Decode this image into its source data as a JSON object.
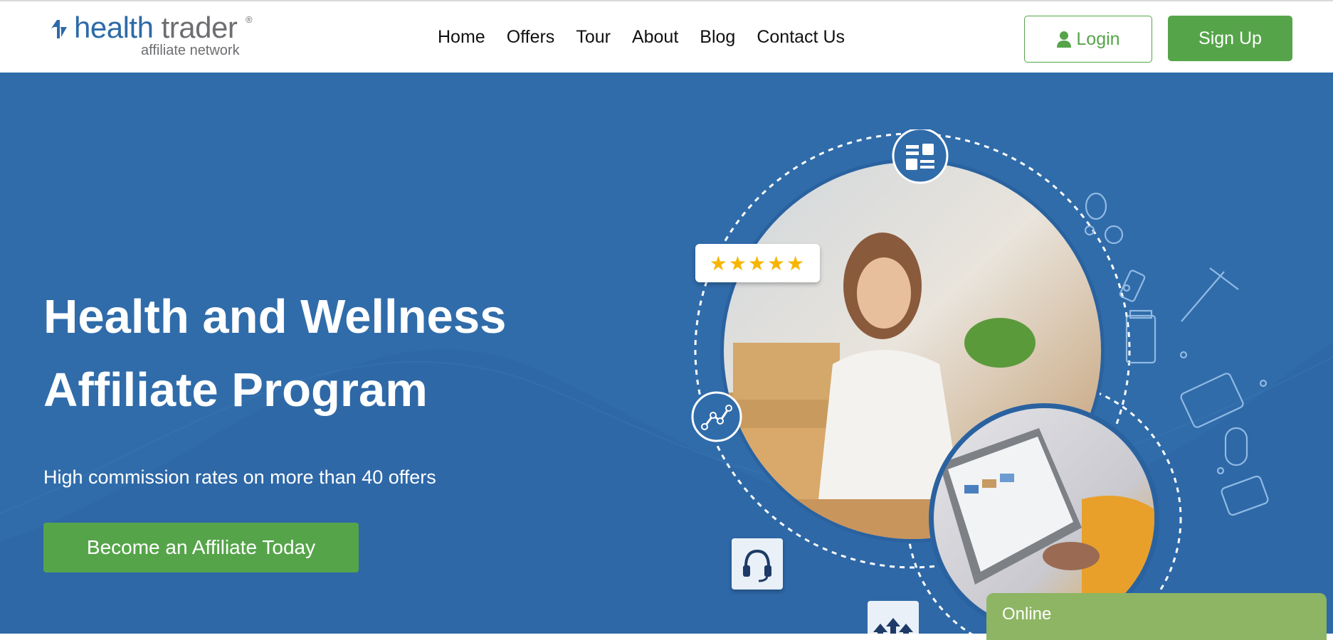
{
  "brand": {
    "name_part1": "health",
    "name_part2": "trader",
    "registered": "®",
    "tagline": "affiliate network"
  },
  "nav": {
    "items": [
      {
        "label": "Home"
      },
      {
        "label": "Offers"
      },
      {
        "label": "Tour"
      },
      {
        "label": "About"
      },
      {
        "label": "Blog"
      },
      {
        "label": "Contact Us"
      }
    ]
  },
  "auth": {
    "login_label": "Login",
    "signup_label": "Sign Up"
  },
  "hero": {
    "title_line1": "Health and Wellness",
    "title_line2": "Affiliate Program",
    "subtitle": "High commission rates on more than 40 offers",
    "cta_label": "Become an Affiliate Today",
    "rating_stars": "★★★★★"
  },
  "chat": {
    "status_label": "Online"
  },
  "colors": {
    "brand_blue": "#2d6aa7",
    "hero_bg": "#306caa",
    "accent_green": "#56a44a",
    "chat_green": "#8db563",
    "star_gold": "#f7b500"
  },
  "icons": [
    "brand-logo-icon",
    "user-icon",
    "dashboard-icon",
    "analytics-icon",
    "headset-icon",
    "growth-arrows-icon"
  ]
}
